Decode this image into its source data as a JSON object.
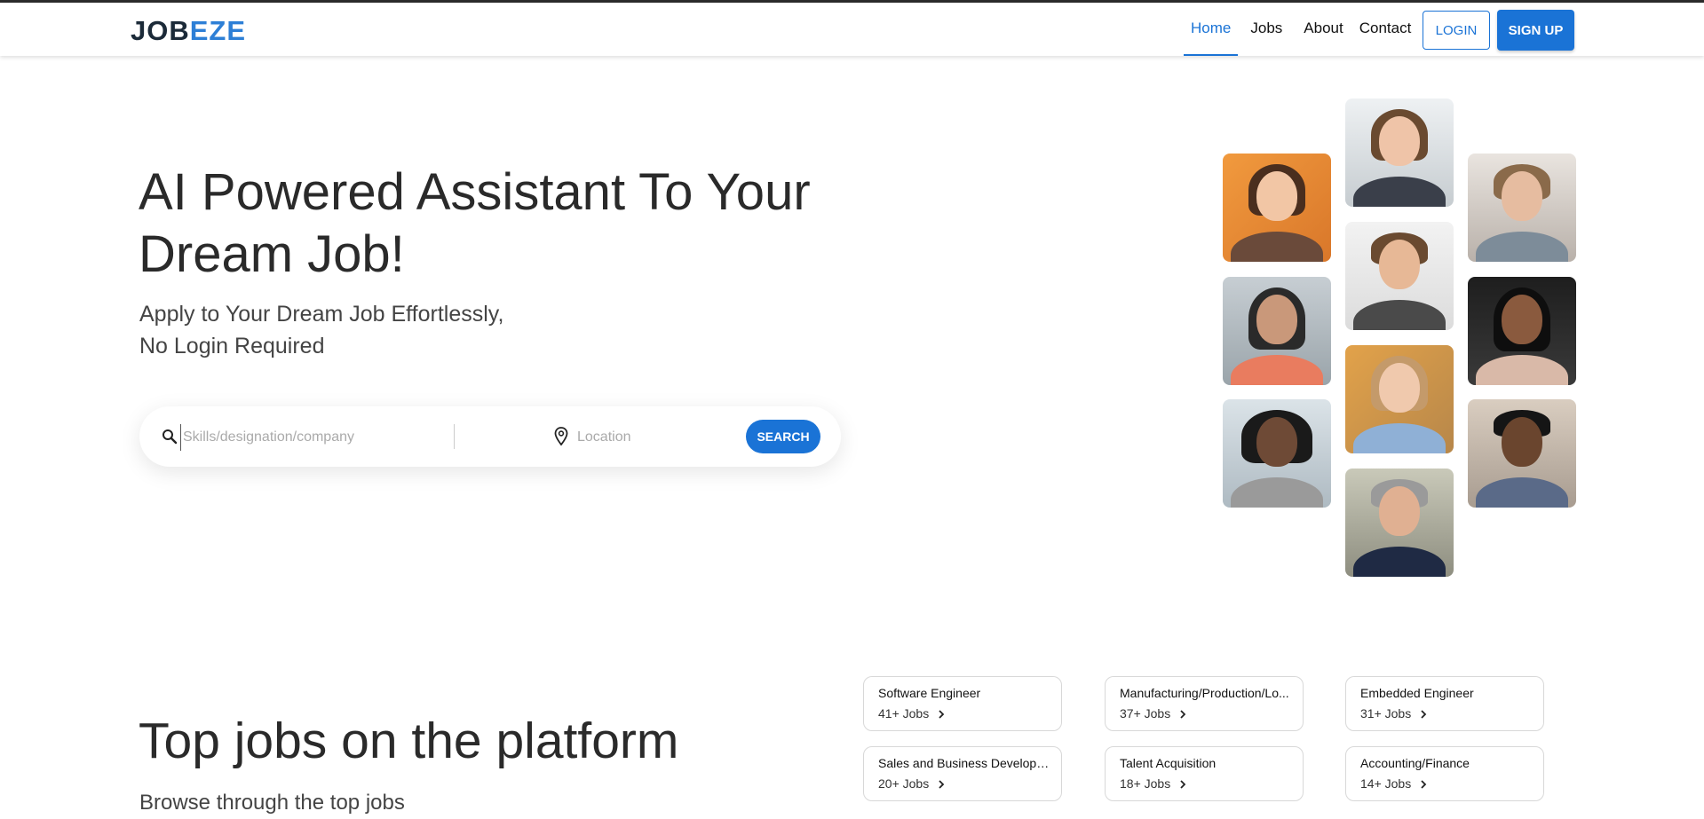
{
  "logo": {
    "part1": "JOB",
    "part2": "EZE"
  },
  "nav": {
    "links": [
      "Home",
      "Jobs",
      "About",
      "Contact"
    ],
    "login": "LOGIN",
    "signup": "SIGN UP"
  },
  "hero": {
    "title_line1": "AI Powered Assistant To Your",
    "title_line2": "Dream Job!",
    "sub_line1": "Apply to Your Dream Job Effortlessly,",
    "sub_line2": "No Login Required"
  },
  "search": {
    "skills_placeholder": "Skills/designation/company",
    "location_placeholder": "Location",
    "button": "SEARCH"
  },
  "top_jobs": {
    "title": "Top jobs on the platform",
    "subtitle": "Browse through the top jobs",
    "cards": [
      {
        "title": "Software Engineer",
        "count": "41+ Jobs"
      },
      {
        "title": "Manufacturing/Production/Lo...",
        "count": "37+ Jobs"
      },
      {
        "title": "Embedded Engineer",
        "count": "31+ Jobs"
      },
      {
        "title": "Sales and Business Developm...",
        "count": "20+ Jobs"
      },
      {
        "title": "Talent Acquisition",
        "count": "18+ Jobs"
      },
      {
        "title": "Accounting/Finance",
        "count": "14+ Jobs"
      }
    ]
  },
  "colors": {
    "primary": "#1a73d6",
    "logo_dark": "#1b2a38",
    "logo_blue": "#2d7fd6"
  },
  "icons": {
    "search": "magnifier-icon",
    "location": "map-pin-icon",
    "chevron": "chevron-right-icon"
  }
}
